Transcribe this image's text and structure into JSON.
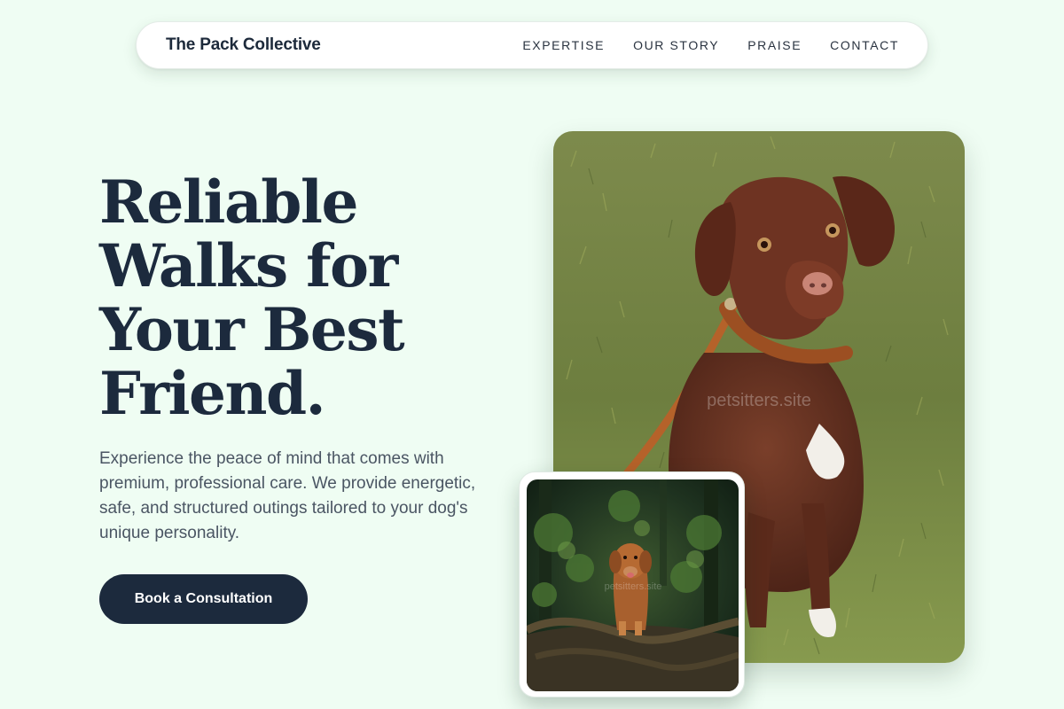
{
  "brand": {
    "name": "The Pack Collective"
  },
  "nav": {
    "links": [
      {
        "label": "EXPERTISE"
      },
      {
        "label": "OUR STORY"
      },
      {
        "label": "PRAISE"
      },
      {
        "label": "CONTACT"
      }
    ]
  },
  "hero": {
    "title_lines": [
      "Reliable",
      "Walks for",
      "Your Best",
      "Friend."
    ],
    "description": "Experience the peace of mind that comes with premium, professional care. We provide energetic, safe, and structured outings tailored to your dog's unique personality.",
    "cta_label": "Book a Consultation"
  },
  "images": {
    "main": {
      "watermark": "petsitters.site",
      "subject": "brown dog sitting on grass with leather leash"
    },
    "small": {
      "watermark": "petsitters.site",
      "subject": "golden dog sitting in a forest"
    }
  },
  "colors": {
    "background": "#effdf3",
    "primary_dark": "#1c2a3d",
    "body_text": "#4a5563",
    "nav_bg": "#ffffff"
  }
}
